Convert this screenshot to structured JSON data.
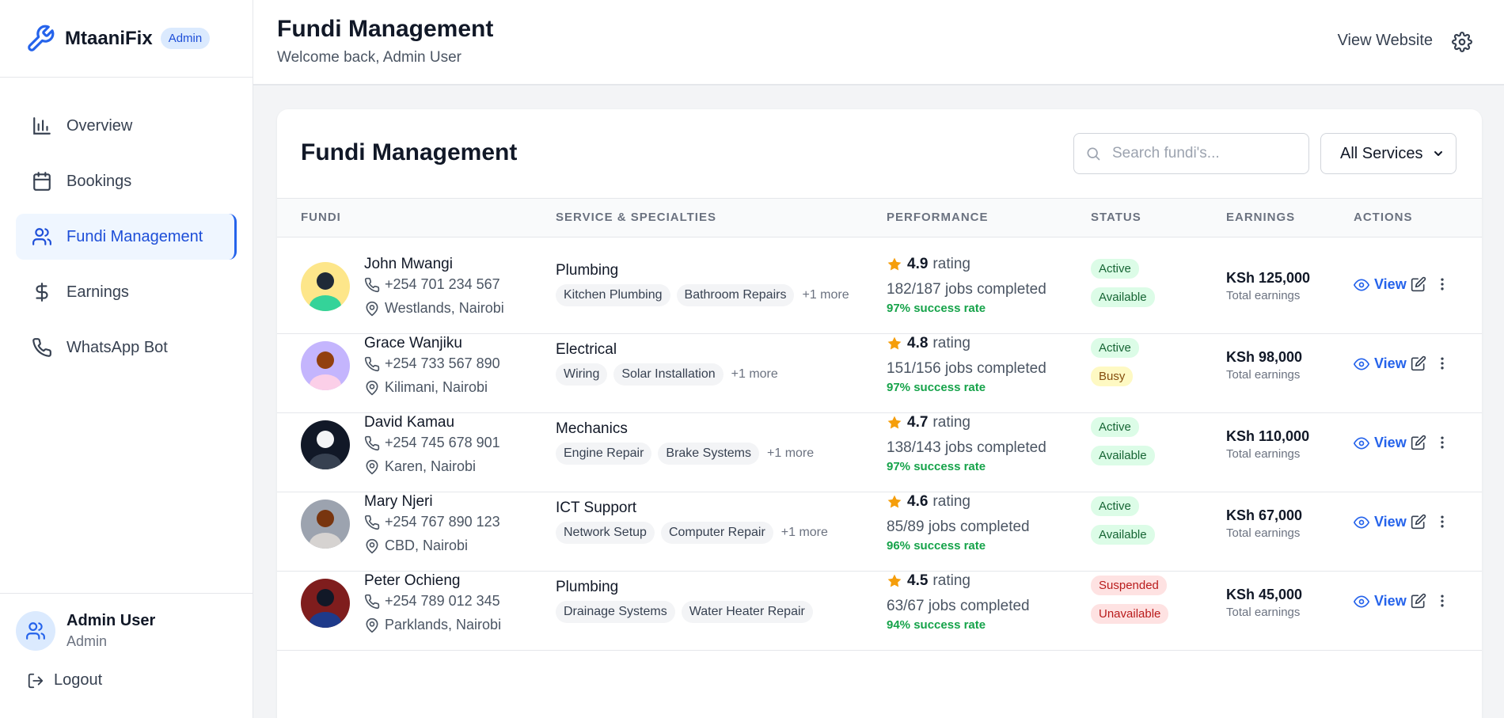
{
  "brand": {
    "name": "MtaaniFix",
    "badge": "Admin"
  },
  "nav": {
    "items": [
      {
        "label": "Overview"
      },
      {
        "label": "Bookings"
      },
      {
        "label": "Fundi Management"
      },
      {
        "label": "Earnings"
      },
      {
        "label": "WhatsApp Bot"
      }
    ],
    "active": "Fundi Management"
  },
  "user": {
    "name": "Admin User",
    "role": "Admin",
    "logout": "Logout"
  },
  "header": {
    "title": "Fundi Management",
    "subtitle": "Welcome back, Admin User",
    "view_website": "View Website"
  },
  "card": {
    "title": "Fundi Management",
    "search_placeholder": "Search fundi's...",
    "filter_value": "All Services"
  },
  "table": {
    "headers": [
      "FUNDI",
      "SERVICE & SPECIALTIES",
      "PERFORMANCE",
      "STATUS",
      "EARNINGS",
      "ACTIONS"
    ],
    "view_label": "View",
    "rating_word": "rating",
    "earnings_sub": "Total earnings",
    "rows": [
      {
        "name": "John Mwangi",
        "phone": "+254 701 234 567",
        "location": "Westlands, Nairobi",
        "service": "Plumbing",
        "tags": [
          "Kitchen Plumbing",
          "Bathroom Repairs"
        ],
        "more": "+1 more",
        "rating": "4.9",
        "jobs": "182/187 jobs completed",
        "success": "97% success rate",
        "status": "Active",
        "availability": "Available",
        "earnings": "KSh 125,000"
      },
      {
        "name": "Grace Wanjiku",
        "phone": "+254 733 567 890",
        "location": "Kilimani, Nairobi",
        "service": "Electrical",
        "tags": [
          "Wiring",
          "Solar Installation"
        ],
        "more": "+1 more",
        "rating": "4.8",
        "jobs": "151/156 jobs completed",
        "success": "97% success rate",
        "status": "Active",
        "availability": "Busy",
        "earnings": "KSh 98,000"
      },
      {
        "name": "David Kamau",
        "phone": "+254 745 678 901",
        "location": "Karen, Nairobi",
        "service": "Mechanics",
        "tags": [
          "Engine Repair",
          "Brake Systems"
        ],
        "more": "+1 more",
        "rating": "4.7",
        "jobs": "138/143 jobs completed",
        "success": "97% success rate",
        "status": "Active",
        "availability": "Available",
        "earnings": "KSh 110,000"
      },
      {
        "name": "Mary Njeri",
        "phone": "+254 767 890 123",
        "location": "CBD, Nairobi",
        "service": "ICT Support",
        "tags": [
          "Network Setup",
          "Computer Repair"
        ],
        "more": "+1 more",
        "rating": "4.6",
        "jobs": "85/89 jobs completed",
        "success": "96% success rate",
        "status": "Active",
        "availability": "Available",
        "earnings": "KSh 67,000"
      },
      {
        "name": "Peter Ochieng",
        "phone": "+254 789 012 345",
        "location": "Parklands, Nairobi",
        "service": "Plumbing",
        "tags": [
          "Drainage Systems",
          "Water Heater Repair"
        ],
        "more": "",
        "rating": "4.5",
        "jobs": "63/67 jobs completed",
        "success": "94% success rate",
        "status": "Suspended",
        "availability": "Unavailable",
        "earnings": "KSh 45,000"
      }
    ]
  },
  "colors": {
    "accent": "#2563eb",
    "success": "#16a34a",
    "star": "#f59e0b"
  }
}
